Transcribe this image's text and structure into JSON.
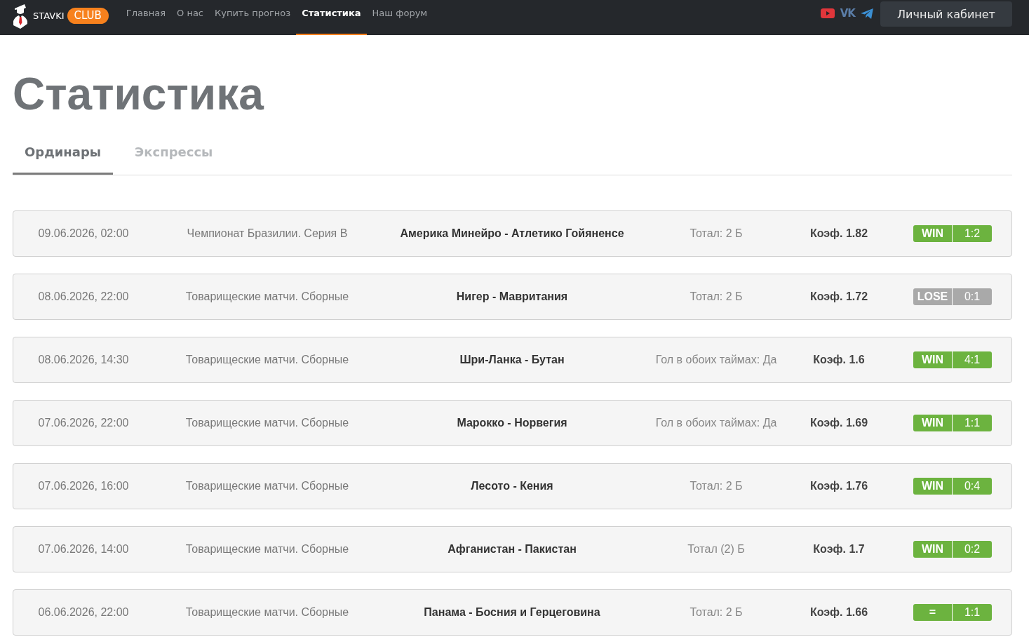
{
  "header": {
    "brand": {
      "name": "STAVKI",
      "badge": "CLUB"
    },
    "nav": [
      {
        "label": "Главная",
        "selected": false
      },
      {
        "label": "О нас",
        "selected": false
      },
      {
        "label": "Купить прогноз",
        "selected": false
      },
      {
        "label": "Статистика",
        "selected": true
      },
      {
        "label": "Наш форум",
        "selected": false
      }
    ],
    "social": [
      {
        "kind": "play"
      },
      {
        "kind": "text",
        "label": "VK"
      },
      {
        "kind": "plane"
      }
    ],
    "account_button": "Личный кабинет"
  },
  "title": "Статистика",
  "tabs": [
    {
      "label": "Ординары",
      "selected": true
    },
    {
      "label": "Экспрессы",
      "selected": false
    }
  ],
  "rows": [
    {
      "date": "09.06.2026, 02:00",
      "league": "Чемпионат Бразилии. Серия B",
      "match": "Америка Минейро - Атлетико Гойяненсе",
      "bet": "Тотал: 2 Б",
      "odds": "Коэф. 1.82",
      "result": {
        "label": "WIN",
        "score": "1:2",
        "color": "#6cb33f"
      }
    },
    {
      "date": "08.06.2026, 22:00",
      "league": "Товарищеские матчи. Сборные",
      "match": "Нигер - Мавритания",
      "bet": "Тотал: 2 Б",
      "odds": "Коэф. 1.72",
      "result": {
        "label": "LOSE",
        "score": "0:1",
        "color": "#a9a9a9"
      }
    },
    {
      "date": "08.06.2026, 14:30",
      "league": "Товарищеские матчи. Сборные",
      "match": "Шри-Ланка - Бутан",
      "bet": "Гол в обоих таймах: Да",
      "odds": "Коэф. 1.6",
      "result": {
        "label": "WIN",
        "score": "4:1",
        "color": "#6cb33f"
      }
    },
    {
      "date": "07.06.2026, 22:00",
      "league": "Товарищеские матчи. Сборные",
      "match": "Марокко - Норвегия",
      "bet": "Гол в обоих таймах: Да",
      "odds": "Коэф. 1.69",
      "result": {
        "label": "WIN",
        "score": "1:1",
        "color": "#6cb33f"
      }
    },
    {
      "date": "07.06.2026, 16:00",
      "league": "Товарищеские матчи. Сборные",
      "match": "Лесото - Кения",
      "bet": "Тотал: 2 Б",
      "odds": "Коэф. 1.76",
      "result": {
        "label": "WIN",
        "score": "0:4",
        "color": "#6cb33f"
      }
    },
    {
      "date": "07.06.2026, 14:00",
      "league": "Товарищеские матчи. Сборные",
      "match": "Афганистан - Пакистан",
      "bet": "Тотал (2) Б",
      "odds": "Коэф. 1.7",
      "result": {
        "label": "WIN",
        "score": "0:2",
        "color": "#6cb33f"
      }
    },
    {
      "date": "06.06.2026, 22:00",
      "league": "Товарищеские матчи. Сборные",
      "match": "Панама - Босния и Герцеговина",
      "bet": "Тотал: 2 Б",
      "odds": "Коэф. 1.66",
      "result": {
        "label": "=",
        "score": "1:1",
        "color": "#6cb33f"
      }
    }
  ]
}
